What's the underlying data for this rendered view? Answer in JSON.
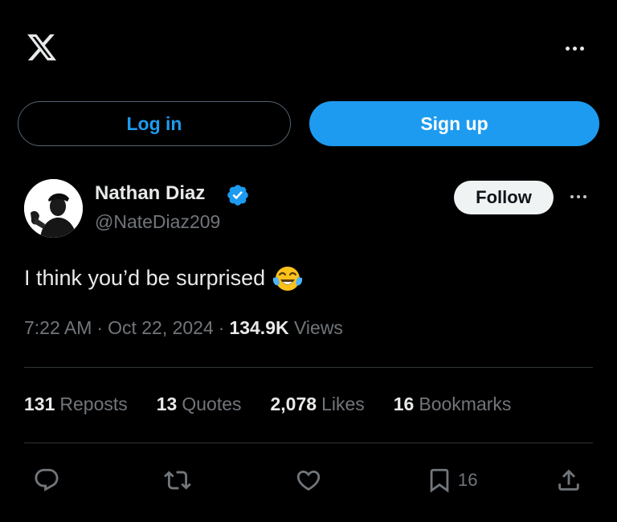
{
  "header": {
    "logo_icon": "x-logo-icon",
    "more_icon": "more-horizontal-icon"
  },
  "auth": {
    "login_label": "Log in",
    "signup_label": "Sign up"
  },
  "author": {
    "name": "Nathan Diaz",
    "handle": "@NateDiaz209",
    "verified": true,
    "follow_label": "Follow"
  },
  "tweet": {
    "text": "I think you’d be surprised",
    "emoji": "face-with-tears-of-joy",
    "time": "7:22 AM",
    "date": "Oct 22, 2024",
    "separator": "·",
    "views_count": "134.9K",
    "views_label": "Views"
  },
  "stats": {
    "reposts": {
      "count": "131",
      "label": "Reposts"
    },
    "quotes": {
      "count": "13",
      "label": "Quotes"
    },
    "likes": {
      "count": "2,078",
      "label": "Likes"
    },
    "bookmarks": {
      "count": "16",
      "label": "Bookmarks"
    }
  },
  "actions": {
    "reply_icon": "reply-icon",
    "repost_icon": "repost-icon",
    "like_icon": "heart-icon",
    "bookmark_icon": "bookmark-icon",
    "bookmark_count": "16",
    "share_icon": "share-icon"
  },
  "colors": {
    "background": "#000000",
    "accent": "#1d9bf0",
    "text_primary": "#e7e9ea",
    "text_secondary": "#71767b",
    "divider": "#2f3336",
    "follow_bg": "#eff3f4"
  }
}
